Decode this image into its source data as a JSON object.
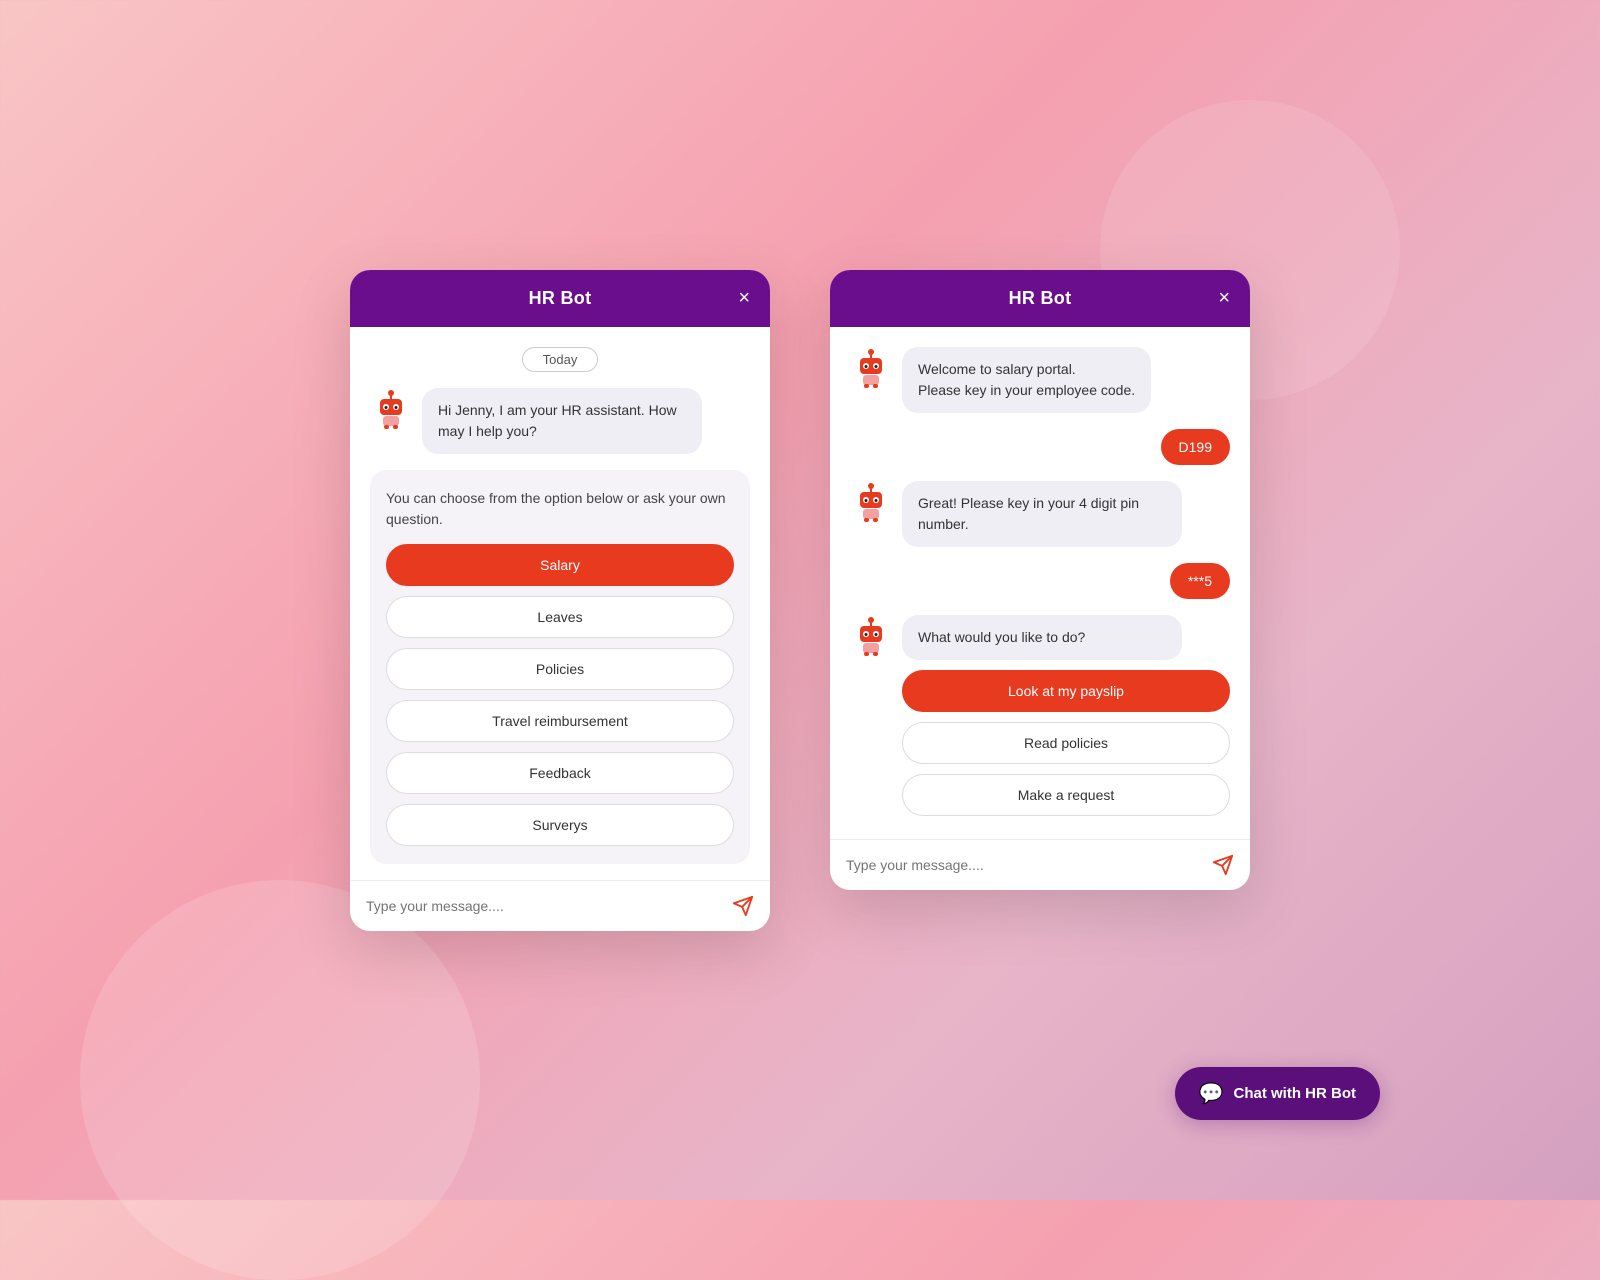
{
  "background": {
    "color_start": "#f9c5c5",
    "color_end": "#d4a0c0"
  },
  "left_window": {
    "header": {
      "title": "HR Bot",
      "close_label": "×"
    },
    "date_badge": "Today",
    "bot_greeting": "Hi Jenny, I am your HR assistant. How may I help you?",
    "options_intro": "You can choose from the option below or ask your own question.",
    "options": [
      "Salary",
      "Leaves",
      "Policies",
      "Travel reimbursement",
      "Feedback",
      "Surverys"
    ],
    "input_placeholder": "Type your message....",
    "active_option_index": 0
  },
  "right_window": {
    "header": {
      "title": "HR Bot",
      "close_label": "×"
    },
    "messages": [
      {
        "type": "bot",
        "text": "Welcome to salary portal.\nPlease key in your employee code."
      },
      {
        "type": "user",
        "text": "D199"
      },
      {
        "type": "bot",
        "text": "Great! Please key in your 4 digit pin number."
      },
      {
        "type": "user",
        "text": "***5"
      },
      {
        "type": "bot",
        "text": "What would you like to do?"
      }
    ],
    "options": [
      "Look at my payslip",
      "Read policies",
      "Make a request"
    ],
    "active_option_index": 0,
    "input_placeholder": "Type your message...."
  },
  "cta_button": {
    "label": "Chat with HR Bot",
    "icon": "💬"
  }
}
